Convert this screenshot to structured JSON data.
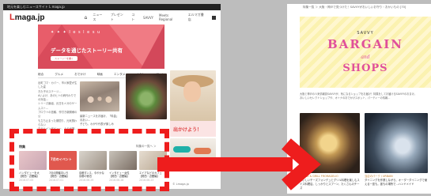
{
  "left": {
    "topbar": "地元を楽しむニュースサイト L maga.jp",
    "logo_mark": "L",
    "logo_text": "maga.jp",
    "nav": [
      "ニュース",
      "プレゼント",
      "コト",
      "SAVVY",
      "Meets Regional",
      "エルマガ書店"
    ],
    "hero": {
      "brand": "✦ ✦ ✦  l e s l e s u",
      "title": "データを通じたストーリー共有",
      "button": "ストーリーを書く"
    },
    "categories": [
      "総合",
      "グルメ",
      "おでかけ",
      "映画",
      "エンタメ",
      "くらし",
      "アート"
    ],
    "article_lines": [
      "出町ゴマ・カパー、市川家愛が生した姿",
      "きた子のステージ…",
      "Aいよけ、あのヒトの肩代わりでの対話…",
      "シリーズ番組、元日をメガのゲームスト…",
      "プロウトの信頼、作付き新鋼様の公",
      "も立ち止まった期間り、元気関わらない",
      "ホテルインタビュー、人の出場…"
    ],
    "article2": [
      "最新ニュースをお届け、「料金」月あい…",
      "子ども、わがや代表が楽しみ"
    ],
    "promo": "出かけよう！",
    "section_label": "特集",
    "section_more": "特集の一覧へ ＞",
    "thumb_badge": "7月のイベント",
    "thumbs": [
      {
        "title": "バンダビューを大",
        "sub": "【関西・近畿編】",
        "date": "2016.07.05"
      },
      {
        "title": "7月の開催中いろ",
        "sub": "【関西・近畿編】",
        "date": "2016.07.01"
      },
      {
        "title": "京都ダンス、今やかな",
        "sub": "京都の宿泊",
        "date": "2016.06.29"
      },
      {
        "title": "インタビュー女性",
        "sub": "【関西・近畿編】",
        "date": "2016.06.28"
      },
      {
        "title": "エイアなどのカフェ",
        "sub": "【関西・近畿編】",
        "date": "2016.06.23"
      }
    ],
    "footer": "© Lmaga.jp"
  },
  "right": {
    "breadcrumb": "特集一覧 ＞ 大阪・神戸で見つけた！SAVVYがおいしいお守り・おかいもの [70]",
    "banner": {
      "savvy": "SAVVY",
      "bargain": "BARGAIN",
      "and": "and",
      "shops": "SHOPS"
    },
    "lines": [
      "大阪と神戸の人気情報誌SAVVYが、気になるショップをお届け！特集をしてお届けるSAVVYのおまけ。",
      "おいしいセレクトショップや、オトナのおでかけスポット、パーティーの情報…"
    ],
    "cap_a": {
      "brand": "ALPINE & GRILL FROMAGELIO",
      "text": "おいしいチーズフォンデュとグリル料理を楽しむスイス料理店。しっかりとスプーン、たくさんのチーズ"
    },
    "cap_b": {
      "brand": "当店のパーク / URBAIN",
      "text": "ダイニングを作業しながら、オーダーダイニングで使える一皿も。誰もの場所で…ハンドメイド"
    }
  },
  "colors": {
    "highlight": "#ee1d1d",
    "accent_pink": "#e0509b",
    "hero_red": "#e85d6a"
  }
}
